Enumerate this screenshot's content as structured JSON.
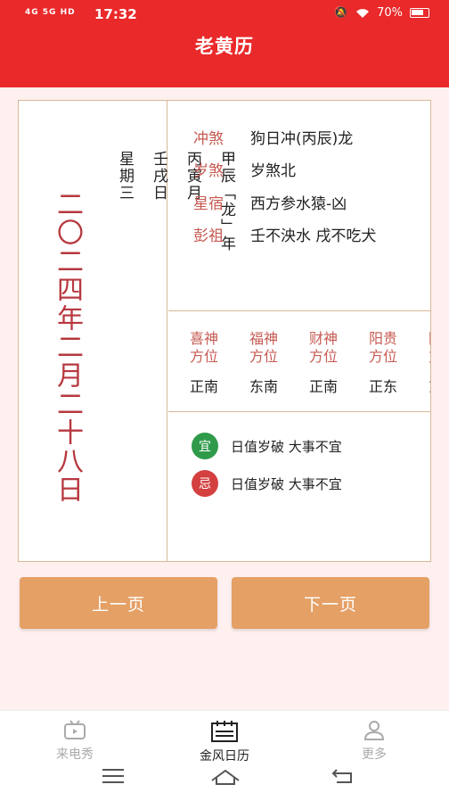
{
  "status": {
    "signal": "4G 5G HD",
    "time": "17:32",
    "battery": "70%"
  },
  "header": {
    "title": "老黄历"
  },
  "date": {
    "lunar_big": "二〇二四年二月二十八日",
    "ganzhi_year": "甲辰「龙」年",
    "ganzhi_month": "丙寅月",
    "ganzhi_day": "壬戌日",
    "weekday": "星期三"
  },
  "info": [
    {
      "key": "冲煞",
      "value": "狗日冲(丙辰)龙"
    },
    {
      "key": "岁煞",
      "value": "岁煞北"
    },
    {
      "key": "星宿",
      "value": "西方参水猿-凶"
    },
    {
      "key": "彭祖",
      "value": "壬不泱水 戌不吃犬"
    }
  ],
  "gods": [
    {
      "name1": "喜神",
      "name2": "方位",
      "dir": "正南"
    },
    {
      "name1": "福神",
      "name2": "方位",
      "dir": "东南"
    },
    {
      "name1": "财神",
      "name2": "方位",
      "dir": "正南"
    },
    {
      "name1": "阳贵",
      "name2": "方位",
      "dir": "正东"
    },
    {
      "name1": "阴贵",
      "name2": "方位",
      "dir": "东北"
    }
  ],
  "yiji": {
    "yi_label": "宜",
    "yi_text": "日值岁破 大事不宜",
    "ji_label": "忌",
    "ji_text": "日值岁破 大事不宜"
  },
  "pager": {
    "prev": "上一页",
    "next": "下一页"
  },
  "nav": [
    {
      "label": "来电秀"
    },
    {
      "label": "金风日历"
    },
    {
      "label": "更多"
    }
  ],
  "colors": {
    "header_red": "#e9292a",
    "accent_orange": "#e5a066",
    "label_red": "#c65a52",
    "yi_green": "#2f9a4a",
    "ji_red": "#d44040"
  }
}
